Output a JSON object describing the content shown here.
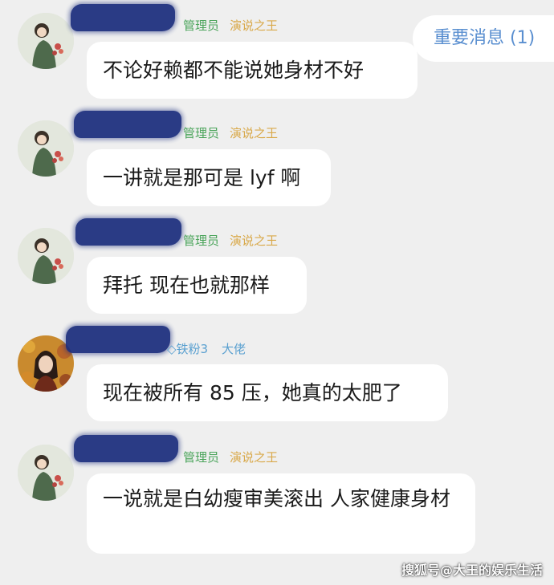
{
  "notice": {
    "label": "重要消息 (1)"
  },
  "messages": [
    {
      "role_badge": "管理员",
      "title_badge": "演说之王",
      "text": "不论好赖都不能说她身材不好"
    },
    {
      "role_badge": "管理员",
      "title_badge": "演说之王",
      "text": "一讲就是那可是 lyf 啊"
    },
    {
      "role_badge": "管理员",
      "title_badge": "演说之王",
      "text": "拜托  现在也就那样"
    },
    {
      "fan_badge": "铁粉3",
      "title_badge": "大佬",
      "text": "现在被所有 85 压，她真的太肥了"
    },
    {
      "role_badge": "管理员",
      "title_badge": "演说之王",
      "text": "一说就是白幼瘦审美滚出  人家健康身材"
    }
  ],
  "watermark": "搜狐号@大王的娱乐生活",
  "icons": {
    "fan": "diamond-icon"
  }
}
